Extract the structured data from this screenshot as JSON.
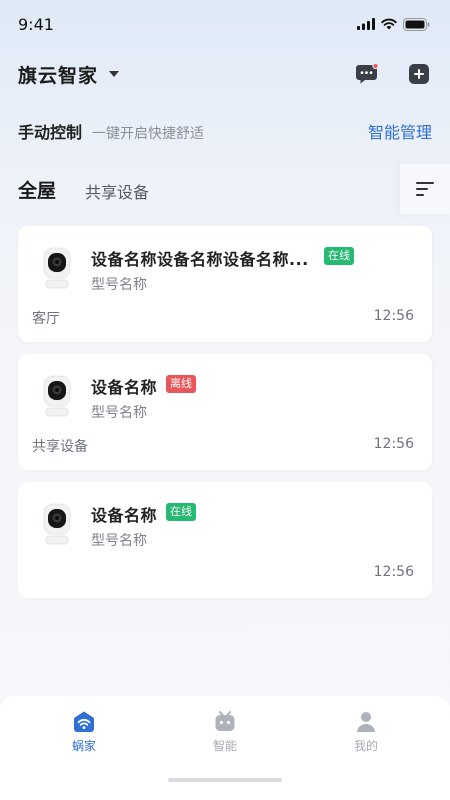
{
  "status_bar": {
    "time": "9:41"
  },
  "header": {
    "home_name": "旗云智家"
  },
  "manual": {
    "title": "手动控制",
    "subtitle": "一键开启快捷舒适",
    "smart_link": "智能管理"
  },
  "tabs": [
    {
      "label": "全屋",
      "active": true
    },
    {
      "label": "共享设备",
      "active": false
    }
  ],
  "devices": [
    {
      "name": "设备名称设备名称设备名称...",
      "status": "在线",
      "status_type": "online",
      "model": "型号名称",
      "room": "客厅",
      "time": "12:56"
    },
    {
      "name": "设备名称",
      "status": "离线",
      "status_type": "offline",
      "model": "型号名称",
      "room": "共享设备",
      "time": "12:56"
    },
    {
      "name": "设备名称",
      "status": "在线",
      "status_type": "online",
      "model": "型号名称",
      "room": "",
      "time": "12:56"
    }
  ],
  "bottom_nav": [
    {
      "label": "蜗家",
      "icon": "home-wifi-icon",
      "active": true
    },
    {
      "label": "智能",
      "icon": "robot-icon",
      "active": false
    },
    {
      "label": "我的",
      "icon": "user-icon",
      "active": false
    }
  ],
  "colors": {
    "accent": "#2f6fd6",
    "online": "#27b871",
    "offline": "#e8585a"
  }
}
